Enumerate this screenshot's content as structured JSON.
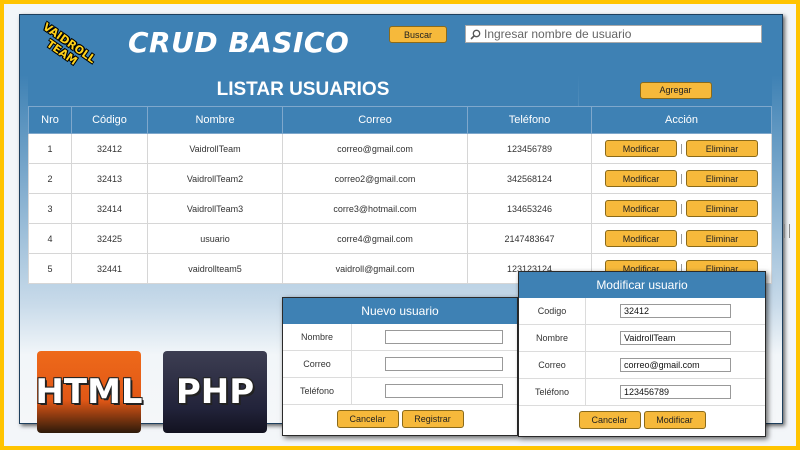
{
  "brand": {
    "logo_line1": "VAIDROLL",
    "logo_line2": "TEAM"
  },
  "header": {
    "title": "CRUD BASICO",
    "search_button": "Buscar",
    "search_placeholder": "Ingresar nombre de usuario"
  },
  "list": {
    "title": "LISTAR USUARIOS",
    "add_button": "Agregar",
    "columns": [
      "Nro",
      "Código",
      "Nombre",
      "Correo",
      "Teléfono",
      "Acción"
    ],
    "rows": [
      {
        "nro": "1",
        "codigo": "32412",
        "nombre": "VaidrollTeam",
        "correo": "correo@gmail.com",
        "telefono": "123456789"
      },
      {
        "nro": "2",
        "codigo": "32413",
        "nombre": "VaidrollTeam2",
        "correo": "correo2@gmail.com",
        "telefono": "342568124"
      },
      {
        "nro": "3",
        "codigo": "32414",
        "nombre": "VaidrollTeam3",
        "correo": "corre3@hotmail.com",
        "telefono": "134653246"
      },
      {
        "nro": "4",
        "codigo": "32425",
        "nombre": "usuario",
        "correo": "corre4@gmail.com",
        "telefono": "2147483647"
      },
      {
        "nro": "5",
        "codigo": "32441",
        "nombre": "vaidrollteam5",
        "correo": "vaidroll@gmail.com",
        "telefono": "123123124"
      }
    ],
    "modify_button": "Modificar",
    "delete_button": "Eliminar"
  },
  "badges": {
    "html": "HTML",
    "php": "PHP"
  },
  "new_user": {
    "title": "Nuevo usuario",
    "fields": [
      {
        "label": "Nombre",
        "value": ""
      },
      {
        "label": "Correo",
        "value": ""
      },
      {
        "label": "Teléfono",
        "value": ""
      }
    ],
    "cancel_button": "Cancelar",
    "submit_button": "Registrar"
  },
  "modify_user": {
    "title": "Modificar usuario",
    "fields": [
      {
        "label": "Codigo",
        "value": "32412"
      },
      {
        "label": "Nombre",
        "value": "VaidrollTeam"
      },
      {
        "label": "Correo",
        "value": "correo@gmail.com"
      },
      {
        "label": "Teléfono",
        "value": "123456789"
      }
    ],
    "cancel_button": "Cancelar",
    "submit_button": "Modificar"
  },
  "colors": {
    "frame": "#ffc400",
    "primary": "#3e81b4",
    "button": "#f6b93b"
  },
  "icons": {
    "search": "magnifier-icon"
  }
}
